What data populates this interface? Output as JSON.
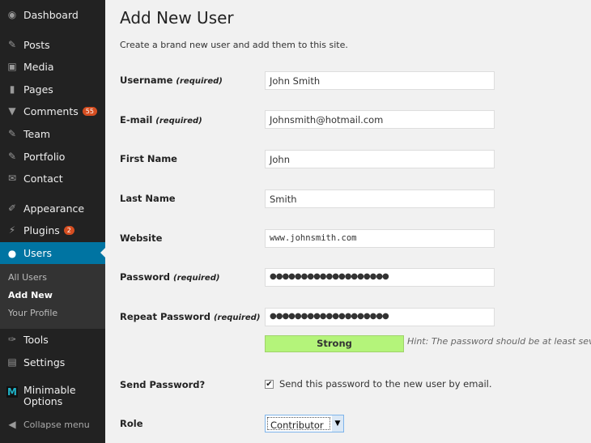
{
  "sidebar": {
    "items": [
      {
        "label": "Dashboard",
        "icon": "dashboard-icon"
      },
      {
        "label": "Posts",
        "icon": "pin-icon"
      },
      {
        "label": "Media",
        "icon": "media-icon"
      },
      {
        "label": "Pages",
        "icon": "pages-icon"
      },
      {
        "label": "Comments",
        "icon": "comment-icon",
        "badge": "55"
      },
      {
        "label": "Team",
        "icon": "pin-icon"
      },
      {
        "label": "Portfolio",
        "icon": "pin-icon"
      },
      {
        "label": "Contact",
        "icon": "envelope-icon"
      },
      {
        "label": "Appearance",
        "icon": "brush-icon"
      },
      {
        "label": "Plugins",
        "icon": "plug-icon",
        "badge": "2"
      },
      {
        "label": "Users",
        "icon": "user-icon"
      },
      {
        "label": "Tools",
        "icon": "wrench-icon"
      },
      {
        "label": "Settings",
        "icon": "settings-icon"
      },
      {
        "label": "Minimable",
        "label2": "Options",
        "icon": "m-logo-icon"
      },
      {
        "label": "Collapse menu",
        "icon": "collapse-icon"
      }
    ],
    "submenu": [
      "All Users",
      "Add New",
      "Your Profile"
    ],
    "active_color": "#0074a2"
  },
  "main": {
    "title": "Add New User",
    "description": "Create a brand new user and add them to this site.",
    "required": "(required)",
    "fields": [
      {
        "label": "Username",
        "required": true,
        "value": "John Smith"
      },
      {
        "label": "E-mail",
        "required": true,
        "value": "Johnsmith@hotmail.com"
      },
      {
        "label": "First Name",
        "value": "John"
      },
      {
        "label": "Last Name",
        "value": "Smith"
      },
      {
        "label": "Website",
        "value": "www.johnsmith.com"
      },
      {
        "label": "Password",
        "required": true,
        "value": "●●●●●●●●●●●●●●●●●●●"
      },
      {
        "label": "Repeat Password",
        "required": true,
        "value": "●●●●●●●●●●●●●●●●●●●"
      }
    ],
    "strength": "Strong",
    "strength_color": "#b4f47a",
    "hint": "Hint: The password should be at least seven ch",
    "send_password": {
      "label": "Send Password?",
      "checkbox_label": "Send this password to the new user by email.",
      "checked": true
    },
    "role": {
      "label": "Role",
      "value": "Contributor"
    }
  }
}
